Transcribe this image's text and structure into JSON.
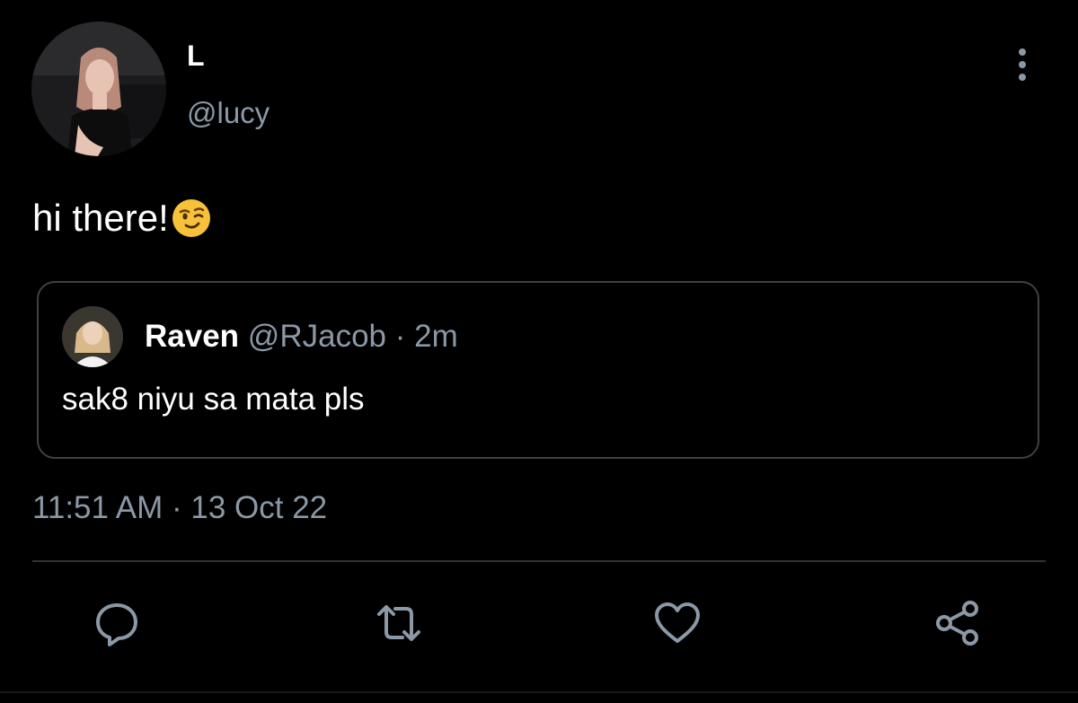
{
  "author": {
    "display_name": "L",
    "handle": "@lucy"
  },
  "tweet": {
    "text": "hi there!",
    "emoji": "winking-face"
  },
  "quoted_tweet": {
    "display_name": "Raven",
    "handle": "@RJacob",
    "separator": "·",
    "age": "2m",
    "text": "sak8 niyu sa mata pls"
  },
  "timestamp": "11:51 AM · 13 Oct 22",
  "actions": {
    "icons": [
      "reply-icon",
      "retweet-icon",
      "like-icon",
      "share-icon"
    ]
  },
  "colors": {
    "background": "#000000",
    "primary_text": "#ffffff",
    "secondary_text": "#8b98a5",
    "border": "#3e4144",
    "icon": "#8b98a5"
  }
}
